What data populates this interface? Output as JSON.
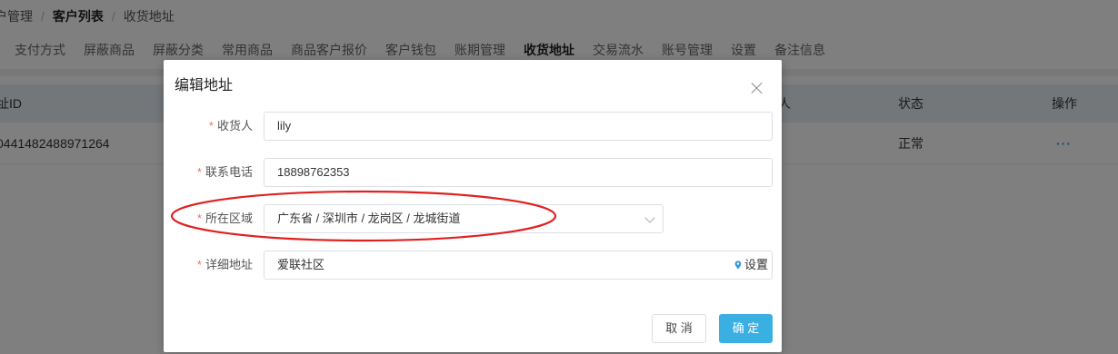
{
  "breadcrumb": {
    "items": [
      "户管理",
      "客户列表",
      "收货地址"
    ]
  },
  "tabs": [
    "支付方式",
    "屏蔽商品",
    "屏蔽分类",
    "常用商品",
    "商品客户报价",
    "客户钱包",
    "账期管理",
    "收货地址",
    "交易流水",
    "账号管理",
    "设置",
    "备注信息"
  ],
  "active_tab": "收货地址",
  "table": {
    "headers": {
      "id": "址ID",
      "person": "人",
      "status": "状态",
      "ops": "操作"
    },
    "rows": [
      {
        "id": "0441482488971264",
        "status": "正常",
        "more": "···"
      }
    ]
  },
  "dialog": {
    "title": "编辑地址",
    "fields": {
      "receiver": {
        "label": "收货人",
        "required_mark": "*",
        "value": "lily"
      },
      "phone": {
        "label": "联系电话",
        "required_mark": "*",
        "value": "18898762353"
      },
      "region": {
        "label": "所在区域",
        "required_mark": "*",
        "value": "广东省 / 深圳市 / 龙岗区 / 龙城街道"
      },
      "address": {
        "label": "详细地址",
        "required_mark": "*",
        "value": "爱联社区",
        "suffix_label": "设置"
      }
    },
    "buttons": {
      "cancel": "取 消",
      "ok": "确 定"
    }
  },
  "colors": {
    "primary": "#3ab0e2",
    "required": "#f56c6c",
    "annotation": "#e02020",
    "pin": "#3a9ad9"
  },
  "icons": [
    "close-icon",
    "chevron-down-icon",
    "location-pin-icon",
    "more-icon"
  ]
}
